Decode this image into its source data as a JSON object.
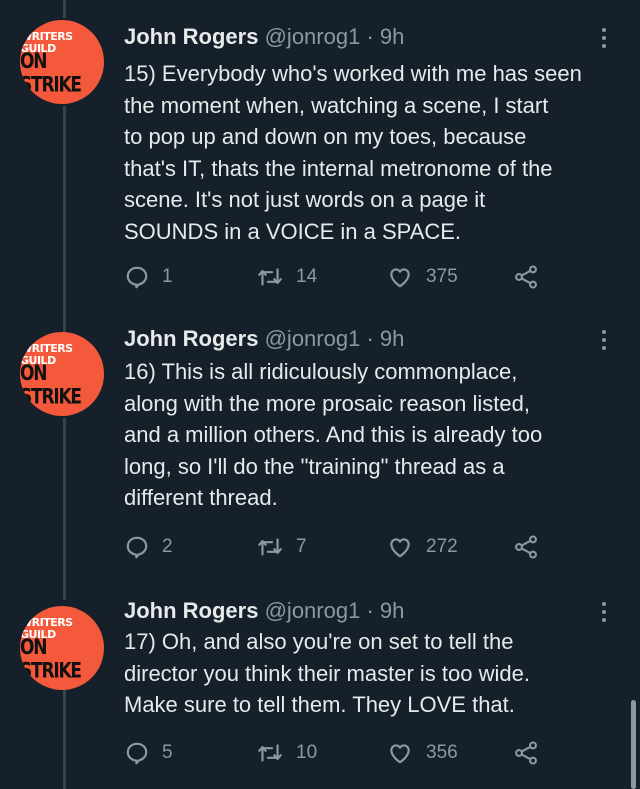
{
  "tweets": [
    {
      "avatar": {
        "line1": "WRITERS GUILD",
        "line2": "ON STRIKE"
      },
      "name": "John Rogers",
      "handle": "@jonrog1",
      "separator": "·",
      "time": "9h",
      "text": "15) Everybody who's worked with me has seen\nthe moment when, watching a scene, I start\nto pop up and down on my toes, because\nthat's IT, thats the internal metronome of the\nscene. It's not just words on a page it\nSOUNDS in a VOICE in a SPACE.",
      "replies": "1",
      "retweets": "14",
      "likes": "375"
    },
    {
      "avatar": {
        "line1": "WRITERS GUILD",
        "line2": "ON STRIKE"
      },
      "name": "John Rogers",
      "handle": "@jonrog1",
      "separator": "·",
      "time": "9h",
      "text": "16) This is all ridiculously commonplace,\nalong with the more prosaic reason listed,\nand a million others. And this is already too\nlong, so I'll do the \"training\" thread as a\ndifferent thread.",
      "replies": "2",
      "retweets": "7",
      "likes": "272"
    },
    {
      "avatar": {
        "line1": "WRITERS GUILD",
        "line2": "ON STRIKE"
      },
      "name": "John Rogers",
      "handle": "@jonrog1",
      "separator": "·",
      "time": "9h",
      "text": "17) Oh, and also you're on set to tell the\ndirector you think their master is too wide.\nMake sure to tell them. They LOVE that.",
      "replies": "5",
      "retweets": "10",
      "likes": "356"
    }
  ],
  "icons": {
    "reply": "speech-bubble-icon",
    "retweet": "retweet-arrows-icon",
    "like": "heart-icon",
    "share": "share-nodes-icon",
    "more": "vertical-ellipsis-icon"
  },
  "colors": {
    "background": "#15202b",
    "text": "#e7e9ea",
    "muted": "#8b98a5",
    "thread_line": "#38444d",
    "avatar_bg": "#f4593b"
  }
}
